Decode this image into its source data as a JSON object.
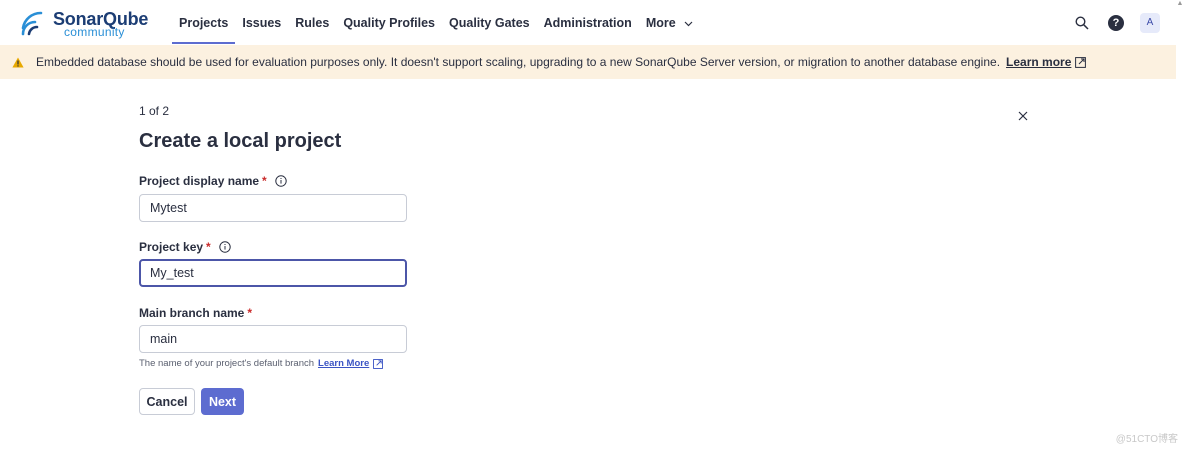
{
  "header": {
    "logo": {
      "name": "SonarQube",
      "edition": "community"
    },
    "nav": [
      {
        "label": "Projects",
        "active": true
      },
      {
        "label": "Issues"
      },
      {
        "label": "Rules"
      },
      {
        "label": "Quality Profiles"
      },
      {
        "label": "Quality Gates"
      },
      {
        "label": "Administration"
      },
      {
        "label": "More"
      }
    ],
    "help_label": "?",
    "avatar_initial": "A"
  },
  "banner": {
    "message": "Embedded database should be used for evaluation purposes only. It doesn't support scaling, upgrading to a new SonarQube Server version, or migration to another database engine.",
    "link_label": "Learn more"
  },
  "form": {
    "step": "1 of 2",
    "title": "Create a local project",
    "display_name": {
      "label": "Project display name",
      "required_mark": "*",
      "value": "Mytest"
    },
    "project_key": {
      "label": "Project key",
      "required_mark": "*",
      "value": "My_test"
    },
    "branch": {
      "label": "Main branch name",
      "required_mark": "*",
      "value": "main",
      "helper": "The name of your project's default branch",
      "helper_link": "Learn More"
    },
    "cancel_label": "Cancel",
    "next_label": "Next"
  },
  "watermark": "@51CTO博客",
  "colors": {
    "primary": "#5d6cd0",
    "banner_bg": "#fcf1e0",
    "warning": "#e8a900",
    "required": "#c92a2a"
  }
}
